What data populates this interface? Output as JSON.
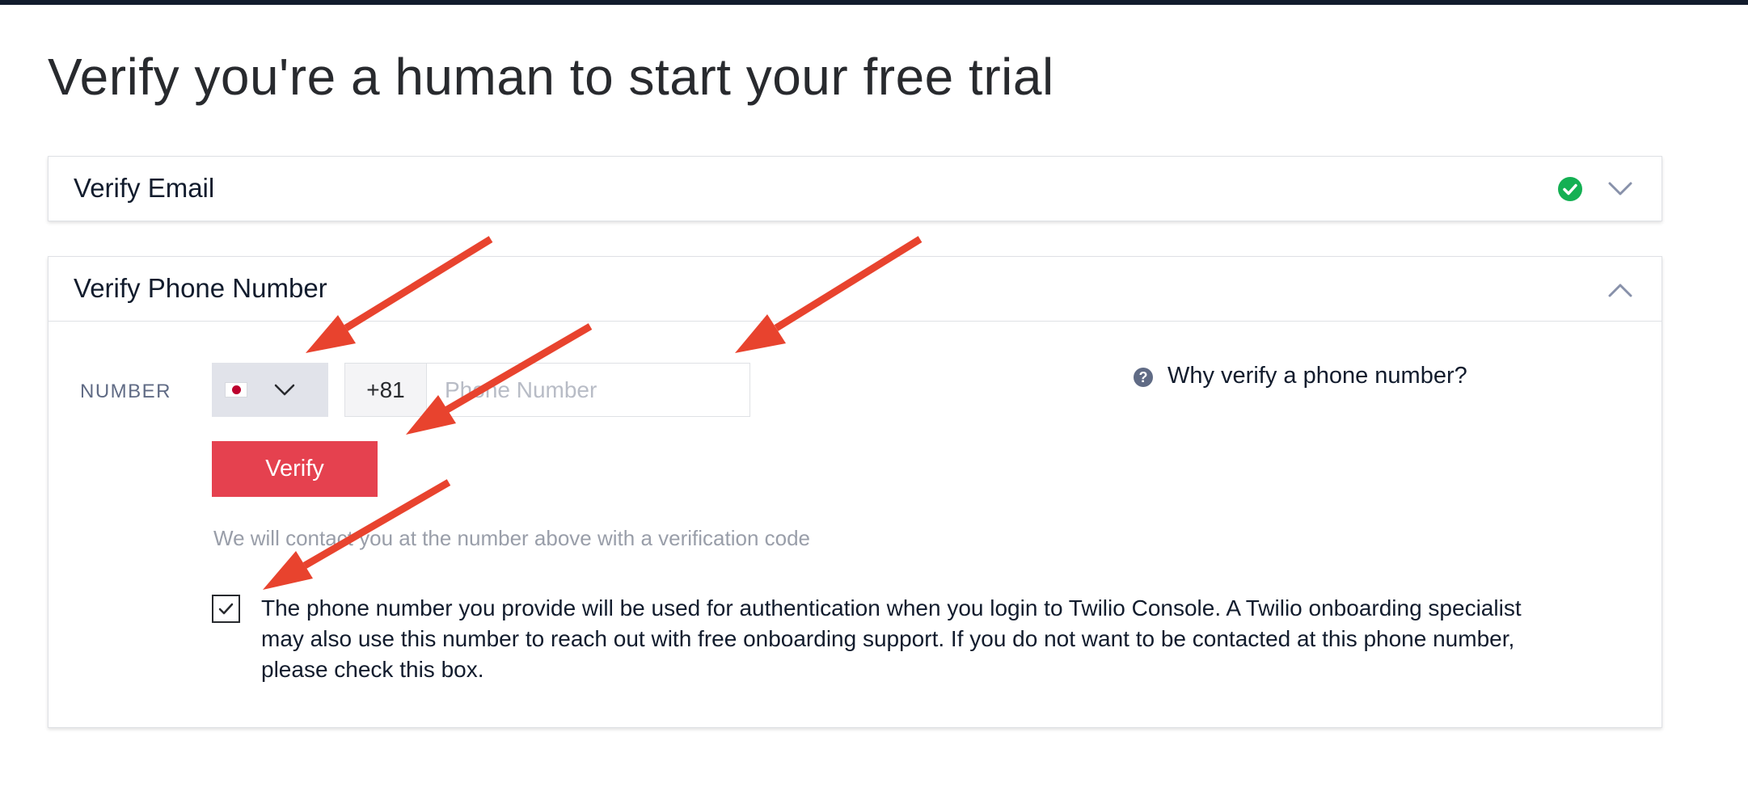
{
  "page": {
    "title": "Verify you're a human to start your free trial"
  },
  "email_section": {
    "title": "Verify Email",
    "status_icon": "check-circle-icon",
    "status_color": "#14b053",
    "expanded": false
  },
  "phone_section": {
    "title": "Verify Phone Number",
    "expanded": true,
    "number_label": "NUMBER",
    "country": {
      "flag": "japan-flag-icon",
      "dial_code": "+81"
    },
    "phone_input": {
      "value": "",
      "placeholder": "Phone Number"
    },
    "verify_button_label": "Verify",
    "help_link_text": "Why verify a phone number?",
    "helper_text": "We will contact you at the number above with a verification code",
    "opt_out_checked": true,
    "consent_text": "The phone number you provide will be used for authentication when you login to Twilio Console. A Twilio onboarding specialist may also use this number to reach out with free onboarding support. If you do not want to be contacted at this phone number, please check this box."
  },
  "colors": {
    "accent_button": "#e5414f",
    "annotation_arrow": "#e8432e",
    "top_bar": "#121c2d"
  },
  "annotations": {
    "arrow_count": 4,
    "arrow_icon": "red-arrow-icon"
  }
}
